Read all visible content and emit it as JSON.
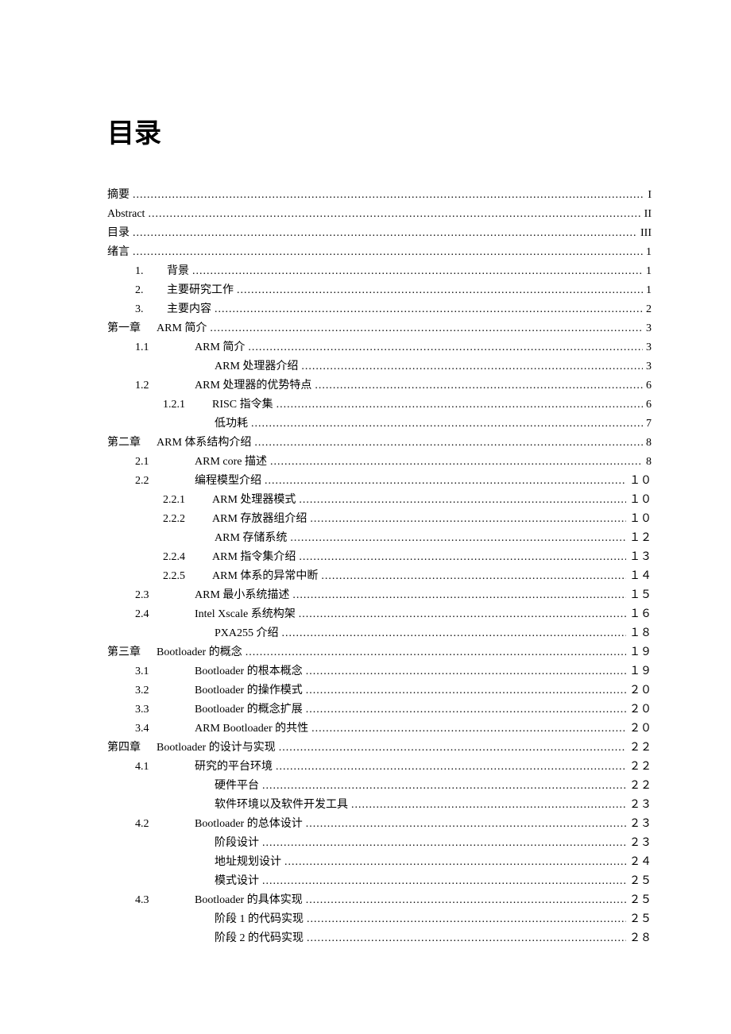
{
  "title": "目录",
  "toc": [
    {
      "level": "i0",
      "num": "",
      "label": "摘要",
      "page": "I"
    },
    {
      "level": "i0",
      "num": "",
      "label": "Abstract",
      "page": "II"
    },
    {
      "level": "i0",
      "num": "",
      "label": "目录",
      "page": "III"
    },
    {
      "level": "i0",
      "num": "",
      "label": "绪言",
      "page": "1"
    },
    {
      "level": "i1",
      "num": "1.",
      "label": "背景",
      "page": "1"
    },
    {
      "level": "i1",
      "num": "2.",
      "label": "主要研究工作",
      "page": "1"
    },
    {
      "level": "i1",
      "num": "3.",
      "label": "主要内容",
      "page": "2"
    },
    {
      "level": "chap",
      "num": "第一章",
      "label": "ARM 简介",
      "page": "3"
    },
    {
      "level": "i2",
      "num": "1.1",
      "label": "ARM 简介",
      "page": "3"
    },
    {
      "level": "i4",
      "num": "",
      "label": "ARM 处理器介绍",
      "page": "3"
    },
    {
      "level": "i2",
      "num": "1.2",
      "label": "ARM 处理器的优势特点",
      "page": "6"
    },
    {
      "level": "i3",
      "num": "1.2.1",
      "label": "RISC 指令集",
      "page": "6"
    },
    {
      "level": "i4",
      "num": "",
      "label": "低功耗",
      "page": "7"
    },
    {
      "level": "chap",
      "num": "第二章",
      "label": "ARM 体系结构介绍",
      "page": "8"
    },
    {
      "level": "i2",
      "num": "2.1",
      "label": "ARM core 描述",
      "page": "8"
    },
    {
      "level": "i2",
      "num": "2.2",
      "label": "编程模型介绍",
      "page": "１０"
    },
    {
      "level": "i3",
      "num": "2.2.1",
      "label": "ARM 处理器模式",
      "page": "１０"
    },
    {
      "level": "i3",
      "num": "2.2.2",
      "label": "ARM 存放器组介绍",
      "page": "１０"
    },
    {
      "level": "i4",
      "num": "",
      "label": "ARM 存储系统",
      "page": "１２"
    },
    {
      "level": "i3",
      "num": "2.2.4",
      "label": "ARM 指令集介绍",
      "page": "１３"
    },
    {
      "level": "i3",
      "num": "2.2.5",
      "label": "ARM 体系的异常中断",
      "page": "１４"
    },
    {
      "level": "i2",
      "num": "2.3",
      "label": "ARM 最小系统描述",
      "page": "１５"
    },
    {
      "level": "i2",
      "num": "2.4",
      "label": "Intel Xscale 系统构架",
      "page": "１６"
    },
    {
      "level": "i4",
      "num": "",
      "label": "PXA255 介绍",
      "page": "１８"
    },
    {
      "level": "chap",
      "num": "第三章",
      "label": "Bootloader 的概念",
      "page": "１９"
    },
    {
      "level": "i2",
      "num": "3.1",
      "label": "Bootloader 的根本概念",
      "page": "１９"
    },
    {
      "level": "i2",
      "num": "3.2",
      "label": "Bootloader 的操作模式",
      "page": "２０"
    },
    {
      "level": "i2",
      "num": "3.3",
      "label": "Bootloader 的概念扩展",
      "page": "２０"
    },
    {
      "level": "i2",
      "num": "3.4",
      "label": "ARM Bootloader 的共性",
      "page": "２０"
    },
    {
      "level": "chap",
      "num": "第四章",
      "label": "Bootloader 的设计与实现",
      "page": "２２"
    },
    {
      "level": "i2",
      "num": "4.1",
      "label": "研究的平台环境",
      "page": "２２"
    },
    {
      "level": "i4",
      "num": "",
      "label": "硬件平台",
      "page": "２２"
    },
    {
      "level": "i4",
      "num": "",
      "label": "软件环境以及软件开发工具",
      "page": "２３"
    },
    {
      "level": "i2",
      "num": "4.2",
      "label": "Bootloader 的总体设计",
      "page": "２３"
    },
    {
      "level": "i4",
      "num": "",
      "label": "阶段设计",
      "page": "２３"
    },
    {
      "level": "i4",
      "num": "",
      "label": "地址规划设计",
      "page": "２４"
    },
    {
      "level": "i4",
      "num": "",
      "label": "模式设计",
      "page": "２５"
    },
    {
      "level": "i2",
      "num": "4.3",
      "label": "Bootloader 的具体实现",
      "page": "２５"
    },
    {
      "level": "i4",
      "num": "",
      "label": "阶段 1 的代码实现",
      "page": "２５"
    },
    {
      "level": "i4",
      "num": "",
      "label": "阶段 2 的代码实现",
      "page": "２８"
    }
  ]
}
